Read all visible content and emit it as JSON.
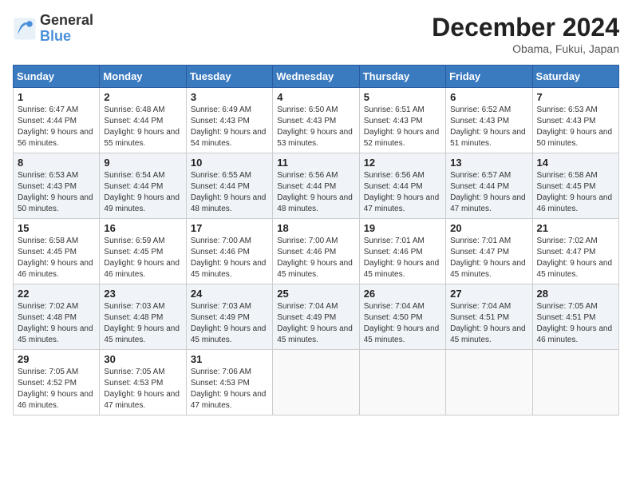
{
  "header": {
    "logo_line1": "General",
    "logo_line2": "Blue",
    "month": "December 2024",
    "location": "Obama, Fukui, Japan"
  },
  "days_of_week": [
    "Sunday",
    "Monday",
    "Tuesday",
    "Wednesday",
    "Thursday",
    "Friday",
    "Saturday"
  ],
  "weeks": [
    [
      {
        "day": 1,
        "sunrise": "6:47 AM",
        "sunset": "4:44 PM",
        "daylight": "9 hours and 56 minutes."
      },
      {
        "day": 2,
        "sunrise": "6:48 AM",
        "sunset": "4:44 PM",
        "daylight": "9 hours and 55 minutes."
      },
      {
        "day": 3,
        "sunrise": "6:49 AM",
        "sunset": "4:43 PM",
        "daylight": "9 hours and 54 minutes."
      },
      {
        "day": 4,
        "sunrise": "6:50 AM",
        "sunset": "4:43 PM",
        "daylight": "9 hours and 53 minutes."
      },
      {
        "day": 5,
        "sunrise": "6:51 AM",
        "sunset": "4:43 PM",
        "daylight": "9 hours and 52 minutes."
      },
      {
        "day": 6,
        "sunrise": "6:52 AM",
        "sunset": "4:43 PM",
        "daylight": "9 hours and 51 minutes."
      },
      {
        "day": 7,
        "sunrise": "6:53 AM",
        "sunset": "4:43 PM",
        "daylight": "9 hours and 50 minutes."
      }
    ],
    [
      {
        "day": 8,
        "sunrise": "6:53 AM",
        "sunset": "4:43 PM",
        "daylight": "9 hours and 50 minutes."
      },
      {
        "day": 9,
        "sunrise": "6:54 AM",
        "sunset": "4:44 PM",
        "daylight": "9 hours and 49 minutes."
      },
      {
        "day": 10,
        "sunrise": "6:55 AM",
        "sunset": "4:44 PM",
        "daylight": "9 hours and 48 minutes."
      },
      {
        "day": 11,
        "sunrise": "6:56 AM",
        "sunset": "4:44 PM",
        "daylight": "9 hours and 48 minutes."
      },
      {
        "day": 12,
        "sunrise": "6:56 AM",
        "sunset": "4:44 PM",
        "daylight": "9 hours and 47 minutes."
      },
      {
        "day": 13,
        "sunrise": "6:57 AM",
        "sunset": "4:44 PM",
        "daylight": "9 hours and 47 minutes."
      },
      {
        "day": 14,
        "sunrise": "6:58 AM",
        "sunset": "4:45 PM",
        "daylight": "9 hours and 46 minutes."
      }
    ],
    [
      {
        "day": 15,
        "sunrise": "6:58 AM",
        "sunset": "4:45 PM",
        "daylight": "9 hours and 46 minutes."
      },
      {
        "day": 16,
        "sunrise": "6:59 AM",
        "sunset": "4:45 PM",
        "daylight": "9 hours and 46 minutes."
      },
      {
        "day": 17,
        "sunrise": "7:00 AM",
        "sunset": "4:46 PM",
        "daylight": "9 hours and 45 minutes."
      },
      {
        "day": 18,
        "sunrise": "7:00 AM",
        "sunset": "4:46 PM",
        "daylight": "9 hours and 45 minutes."
      },
      {
        "day": 19,
        "sunrise": "7:01 AM",
        "sunset": "4:46 PM",
        "daylight": "9 hours and 45 minutes."
      },
      {
        "day": 20,
        "sunrise": "7:01 AM",
        "sunset": "4:47 PM",
        "daylight": "9 hours and 45 minutes."
      },
      {
        "day": 21,
        "sunrise": "7:02 AM",
        "sunset": "4:47 PM",
        "daylight": "9 hours and 45 minutes."
      }
    ],
    [
      {
        "day": 22,
        "sunrise": "7:02 AM",
        "sunset": "4:48 PM",
        "daylight": "9 hours and 45 minutes."
      },
      {
        "day": 23,
        "sunrise": "7:03 AM",
        "sunset": "4:48 PM",
        "daylight": "9 hours and 45 minutes."
      },
      {
        "day": 24,
        "sunrise": "7:03 AM",
        "sunset": "4:49 PM",
        "daylight": "9 hours and 45 minutes."
      },
      {
        "day": 25,
        "sunrise": "7:04 AM",
        "sunset": "4:49 PM",
        "daylight": "9 hours and 45 minutes."
      },
      {
        "day": 26,
        "sunrise": "7:04 AM",
        "sunset": "4:50 PM",
        "daylight": "9 hours and 45 minutes."
      },
      {
        "day": 27,
        "sunrise": "7:04 AM",
        "sunset": "4:51 PM",
        "daylight": "9 hours and 45 minutes."
      },
      {
        "day": 28,
        "sunrise": "7:05 AM",
        "sunset": "4:51 PM",
        "daylight": "9 hours and 46 minutes."
      }
    ],
    [
      {
        "day": 29,
        "sunrise": "7:05 AM",
        "sunset": "4:52 PM",
        "daylight": "9 hours and 46 minutes."
      },
      {
        "day": 30,
        "sunrise": "7:05 AM",
        "sunset": "4:53 PM",
        "daylight": "9 hours and 47 minutes."
      },
      {
        "day": 31,
        "sunrise": "7:06 AM",
        "sunset": "4:53 PM",
        "daylight": "9 hours and 47 minutes."
      },
      null,
      null,
      null,
      null
    ]
  ],
  "labels": {
    "sunrise": "Sunrise:",
    "sunset": "Sunset:",
    "daylight": "Daylight:"
  }
}
